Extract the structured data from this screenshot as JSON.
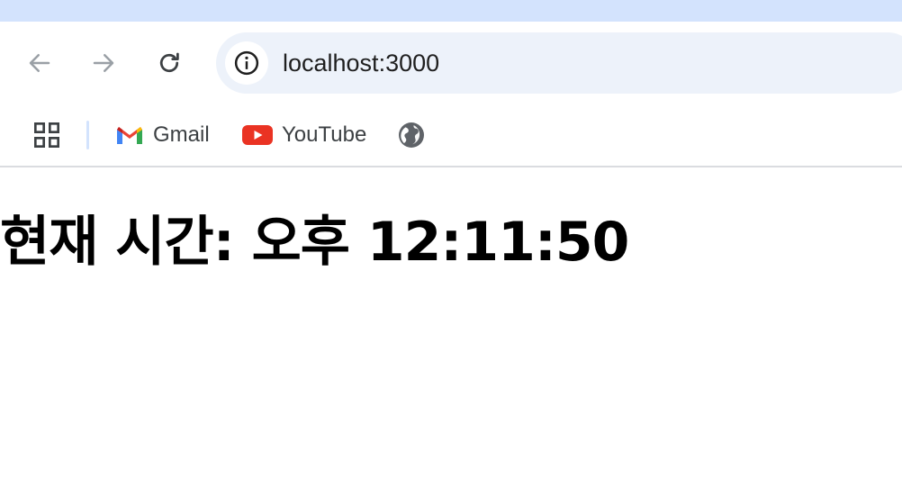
{
  "browser": {
    "address_bar": {
      "url": "localhost:3000"
    },
    "nav_icons": {
      "back": "arrow-left-icon",
      "forward": "arrow-right-icon",
      "reload": "reload-icon",
      "site_info": "info-icon"
    },
    "bookmarks": [
      {
        "label": "Gmail",
        "icon": "gmail-icon"
      },
      {
        "label": "YouTube",
        "icon": "youtube-icon"
      },
      {
        "label": "",
        "icon": "globe-icon"
      }
    ],
    "colors": {
      "tabstrip": "#d3e3fd",
      "omnibox": "#edf2fa",
      "youtube_red": "#ea3323"
    }
  },
  "page": {
    "heading": "현재 시간: 오후 12:11:50"
  }
}
